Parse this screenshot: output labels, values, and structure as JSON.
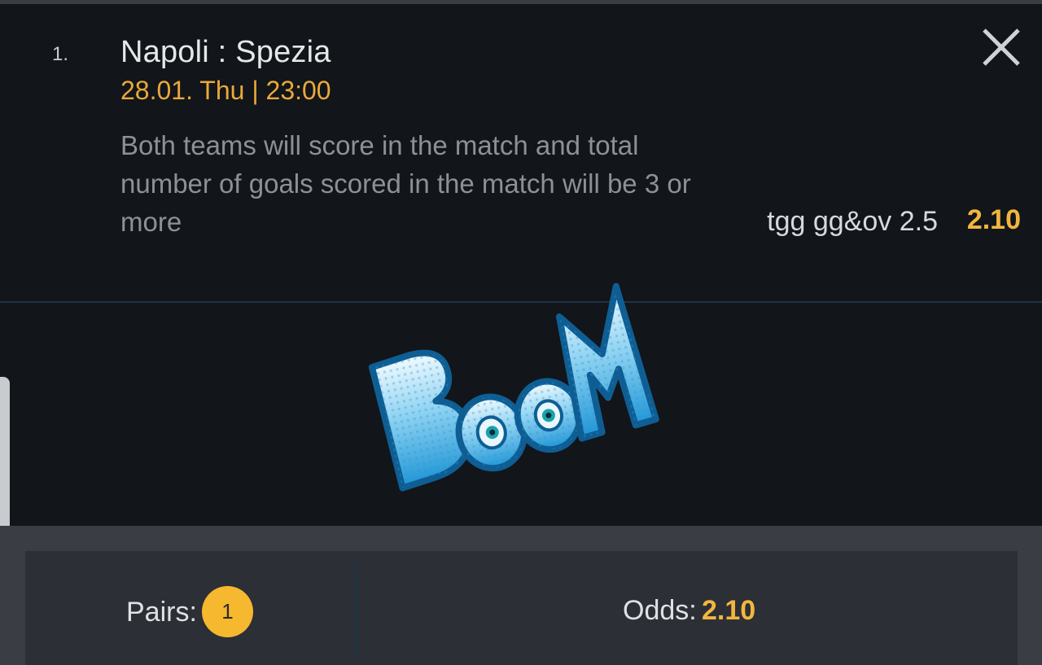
{
  "bet": {
    "index": "1.",
    "match": "Napoli : Spezia",
    "datetime": "28.01. Thu | 23:00",
    "description": "Both teams will score in the match and total number of goals scored in the match will be 3 or more",
    "market_code": "tgg gg&ov 2.5",
    "odds": "2.10",
    "close_icon": "close-icon"
  },
  "sticker": {
    "text": "BOOM",
    "icon": "boom-sticker"
  },
  "summary": {
    "pairs_label": "Pairs:",
    "pairs_count": "1",
    "odds_label": "Odds:",
    "odds_value": "2.10"
  },
  "colors": {
    "background": "#121519",
    "accent": "#f2b63e",
    "footer": "#3a3d44",
    "panel": "#2c2f35",
    "divider": "#1e3446"
  }
}
